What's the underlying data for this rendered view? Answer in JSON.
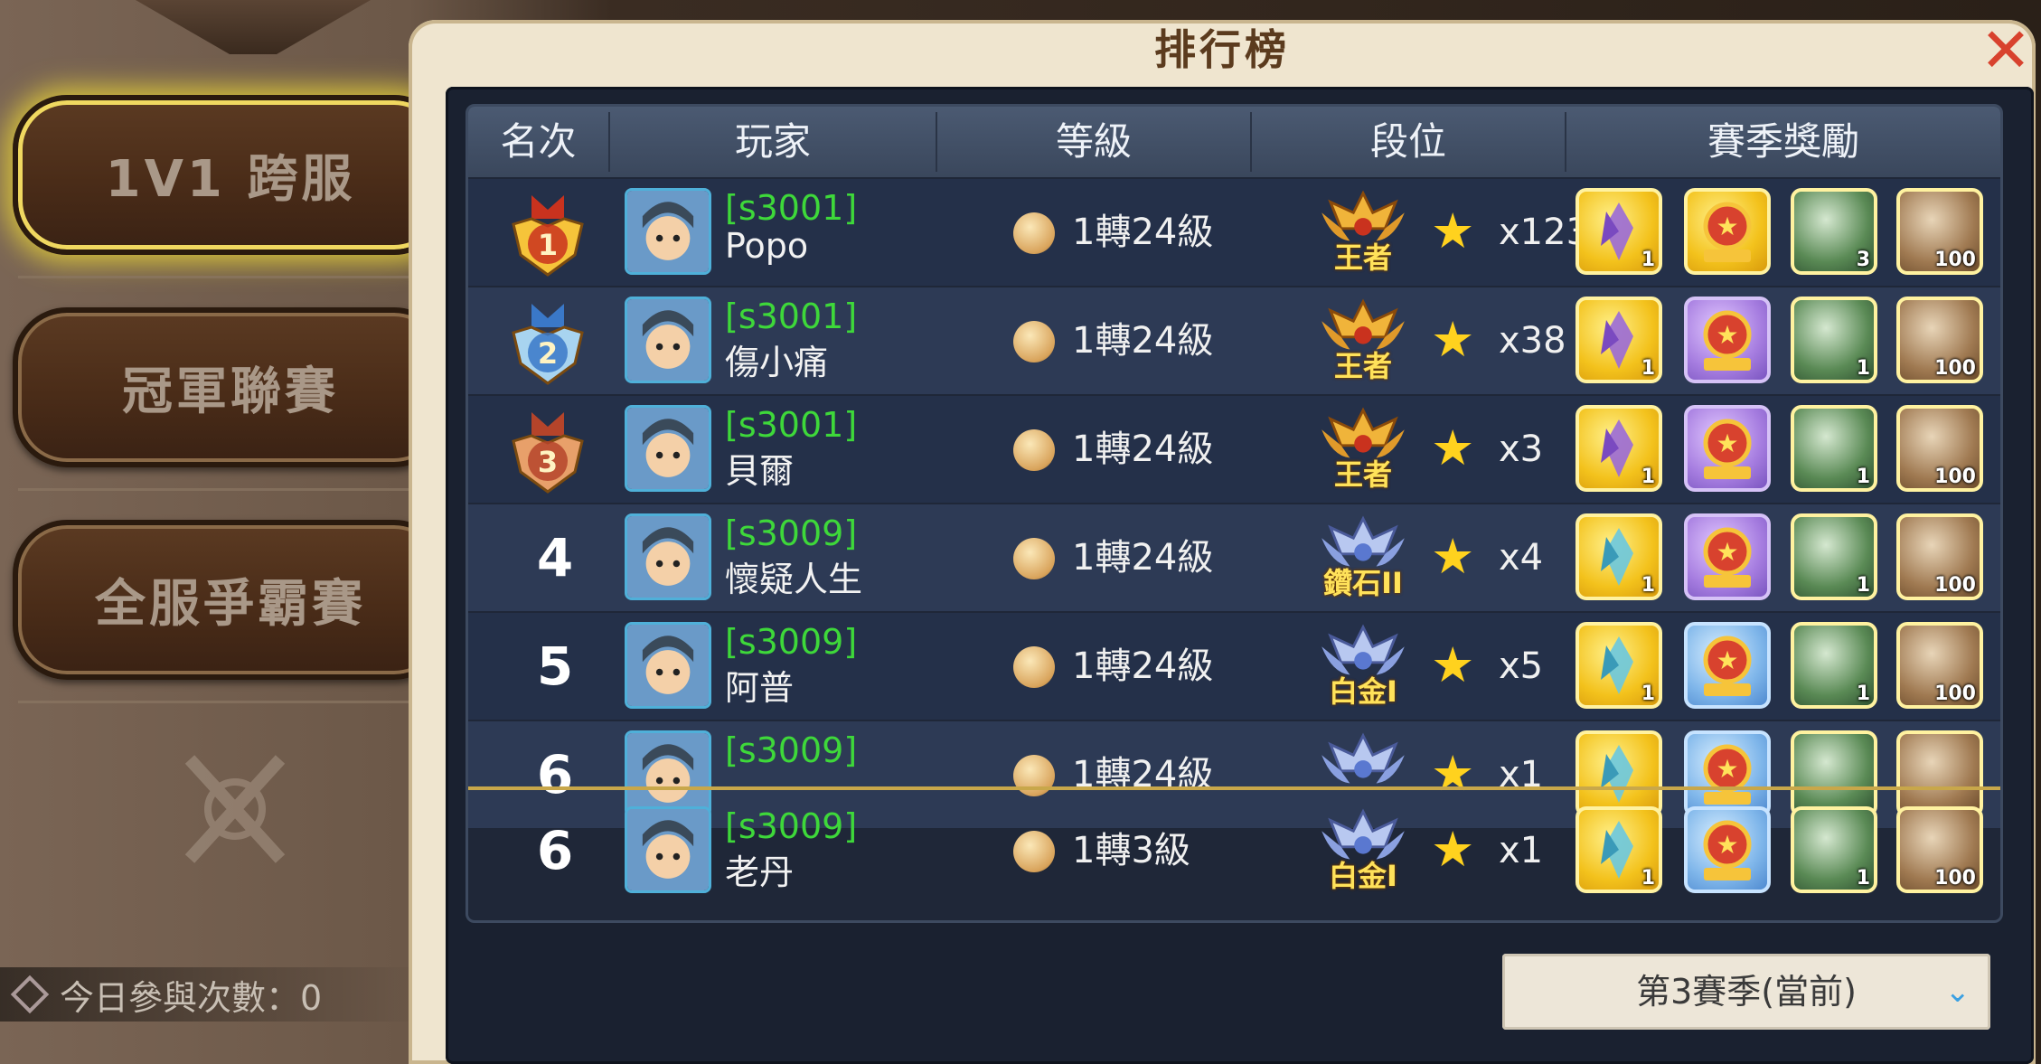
{
  "side": {
    "btn_1v1": "1V1 跨服",
    "btn_champion": "冠軍聯賽",
    "btn_all_server": "全服爭霸賽",
    "daily_count": "今日參與次數：0"
  },
  "dialog": {
    "title": "排行榜",
    "close_icon": "close-icon",
    "headers": [
      "名次",
      "玩家",
      "等級",
      "段位",
      "賽季獎勵"
    ],
    "rows": [
      {
        "rank": "1",
        "medal": "gold-medal",
        "server": "[s3001]",
        "name": "Popo",
        "level": "1轉24級",
        "tier": "王者",
        "stars": "x123",
        "rewards": [
          "gold",
          "gold",
          "green",
          "brown"
        ],
        "reward_counts": [
          "1",
          "",
          "3",
          "100"
        ]
      },
      {
        "rank": "2",
        "medal": "silver-medal",
        "server": "[s3001]",
        "name": "傷小痛",
        "level": "1轉24級",
        "tier": "王者",
        "stars": "x38",
        "rewards": [
          "gold",
          "purple",
          "green",
          "brown"
        ],
        "reward_counts": [
          "1",
          "",
          "1",
          "100"
        ]
      },
      {
        "rank": "3",
        "medal": "bronze-medal",
        "server": "[s3001]",
        "name": "貝爾",
        "level": "1轉24級",
        "tier": "王者",
        "stars": "x3",
        "rewards": [
          "gold",
          "purple",
          "green",
          "brown"
        ],
        "reward_counts": [
          "1",
          "",
          "1",
          "100"
        ]
      },
      {
        "rank": "4",
        "medal": "",
        "server": "[s3009]",
        "name": "懷疑人生",
        "level": "1轉24級",
        "tier": "鑽石II",
        "stars": "x4",
        "rewards": [
          "gold",
          "purple",
          "green",
          "brown"
        ],
        "reward_counts": [
          "1",
          "",
          "1",
          "100"
        ]
      },
      {
        "rank": "5",
        "medal": "",
        "server": "[s3009]",
        "name": "阿普",
        "level": "1轉24級",
        "tier": "白金I",
        "stars": "x5",
        "rewards": [
          "gold",
          "blue",
          "green",
          "brown"
        ],
        "reward_counts": [
          "1",
          "",
          "1",
          "100"
        ]
      },
      {
        "rank": "6",
        "medal": "",
        "server": "[s3009]",
        "name": "",
        "level": "1轉24級",
        "tier": "",
        "stars": "x1",
        "rewards": [
          "gold",
          "blue",
          "green",
          "brown"
        ],
        "reward_counts": [
          "",
          "",
          "",
          ""
        ]
      }
    ],
    "my_row": {
      "rank": "6",
      "server": "[s3009]",
      "name": "老丹",
      "level": "1轉3級",
      "tier": "白金I",
      "stars": "x1",
      "rewards": [
        "gold",
        "blue",
        "green",
        "brown"
      ],
      "reward_counts": [
        "1",
        "",
        "1",
        "100"
      ]
    },
    "season_select": "第3賽季(當前)"
  },
  "colors": {
    "server_green": "#3ed83a",
    "gold_text": "#ffe25a",
    "star": "#ffd21e",
    "close": "#d8422e"
  }
}
